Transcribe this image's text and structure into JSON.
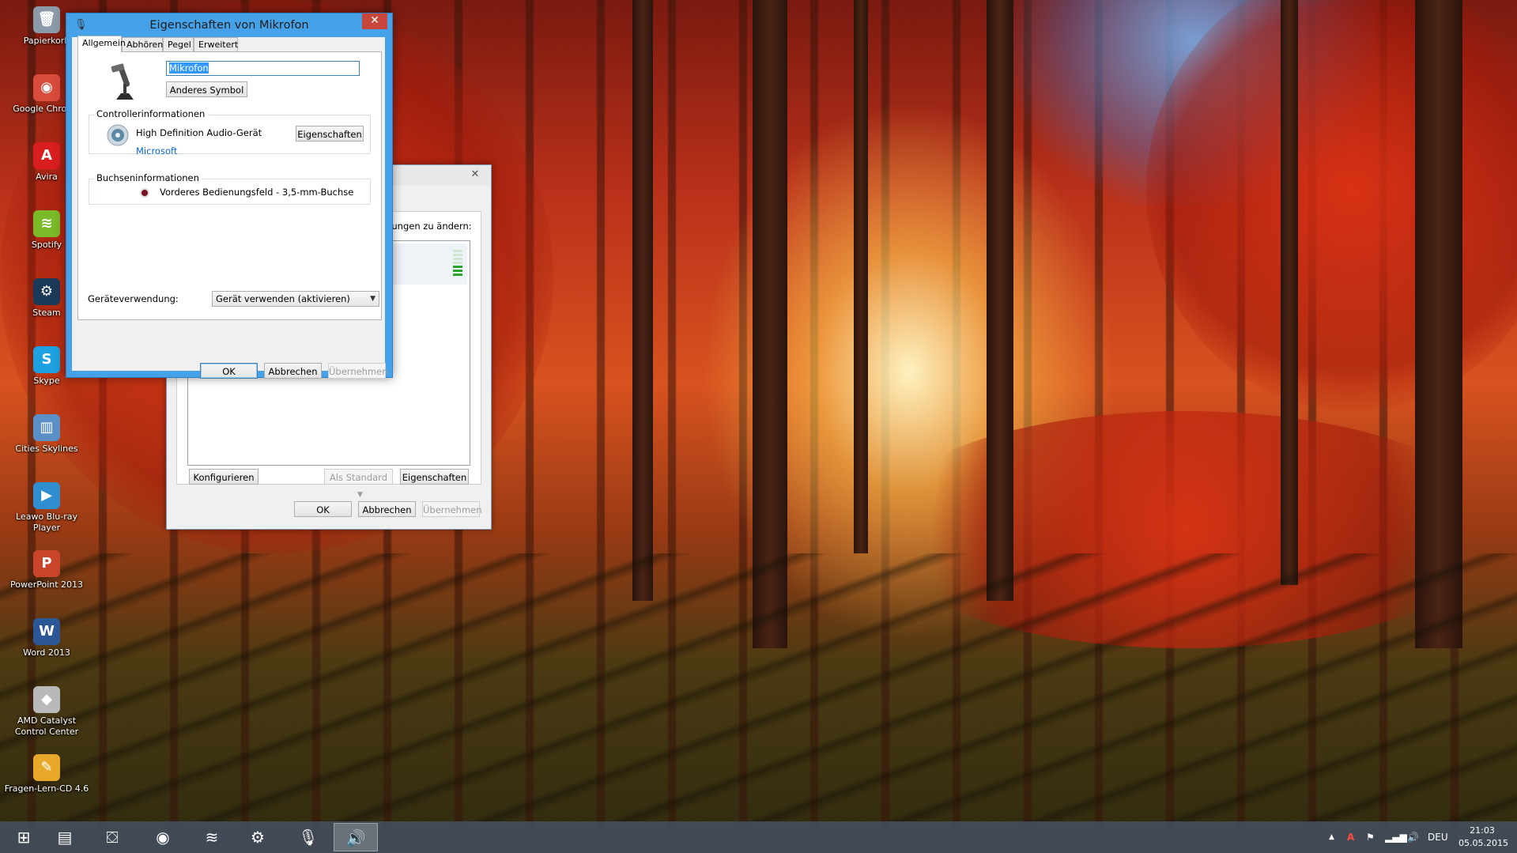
{
  "desktop": {
    "icons": [
      {
        "label": "Papierkorb",
        "icon": "recycle-bin-icon",
        "color": "#8a9aa8",
        "glyph": "🗑"
      },
      {
        "label": "Google Chrome",
        "icon": "chrome-icon",
        "color": "#d94b3b",
        "glyph": "◉"
      },
      {
        "label": "Avira",
        "icon": "avira-icon",
        "color": "#d81e1e",
        "glyph": "A"
      },
      {
        "label": "Spotify",
        "icon": "spotify-icon",
        "color": "#7ab928",
        "glyph": "≋"
      },
      {
        "label": "Steam",
        "icon": "steam-icon",
        "color": "#1b3a5a",
        "glyph": "⚙"
      },
      {
        "label": "Skype",
        "icon": "skype-icon",
        "color": "#1ea1e0",
        "glyph": "S"
      },
      {
        "label": "Cities Skylines",
        "icon": "cities-skylines-icon",
        "color": "#5a8fc8",
        "glyph": "▥"
      },
      {
        "label": "Leawo Blu-ray Player",
        "icon": "leawo-icon",
        "color": "#2f8ed0",
        "glyph": "▶"
      },
      {
        "label": "PowerPoint 2013",
        "icon": "powerpoint-icon",
        "color": "#c8452a",
        "glyph": "P"
      },
      {
        "label": "Word 2013",
        "icon": "word-icon",
        "color": "#2b5797",
        "glyph": "W"
      },
      {
        "label": "AMD Catalyst Control Center",
        "icon": "amd-catalyst-icon",
        "color": "#b9b9b9",
        "glyph": "◆"
      },
      {
        "label": "Fragen-Lern-CD 4.6",
        "icon": "fragen-lern-cd-icon",
        "color": "#e8a92a",
        "glyph": "✎"
      }
    ]
  },
  "back_dialog": {
    "hint": "llungen zu ändern:",
    "configure_label": "Konfigurieren",
    "default_label": "Als Standard",
    "properties_label": "Eigenschaften",
    "ok_label": "OK",
    "cancel_label": "Abbrechen",
    "apply_label": "Übernehmen",
    "close_glyph": "✕"
  },
  "dialog": {
    "title": "Eigenschaften von Mikrofon",
    "close_glyph": "✕",
    "tabs": [
      "Allgemein",
      "Abhören",
      "Pegel",
      "Erweitert"
    ],
    "device_name": "Mikrofon",
    "change_icon_label": "Anderes Symbol",
    "controller_group": "Controllerinformationen",
    "controller_name": "High Definition Audio-Gerät",
    "controller_vendor": "Microsoft",
    "controller_props_label": "Eigenschaften",
    "jack_group": "Buchseninformationen",
    "jack_text": "Vorderes Bedienungsfeld - 3,5-mm-Buchse",
    "usage_label": "Geräteverwendung:",
    "usage_value": "Gerät verwenden (aktivieren)",
    "ok_label": "OK",
    "cancel_label": "Abbrechen",
    "apply_label": "Übernehmen"
  },
  "taskbar": {
    "items": [
      {
        "icon": "windows-start-icon",
        "glyph": "⊞"
      },
      {
        "icon": "file-explorer-icon",
        "glyph": "▤"
      },
      {
        "icon": "windows-store-icon",
        "glyph": "⛋"
      },
      {
        "icon": "chrome-icon",
        "glyph": "◉"
      },
      {
        "icon": "spotify-icon",
        "glyph": "≋"
      },
      {
        "icon": "steam-icon",
        "glyph": "⚙"
      },
      {
        "icon": "microphone-icon",
        "glyph": "🎙"
      },
      {
        "icon": "sound-icon",
        "glyph": "🔊"
      }
    ],
    "tray": {
      "language": "DEU",
      "time": "21:03",
      "date": "05.05.2015"
    }
  }
}
